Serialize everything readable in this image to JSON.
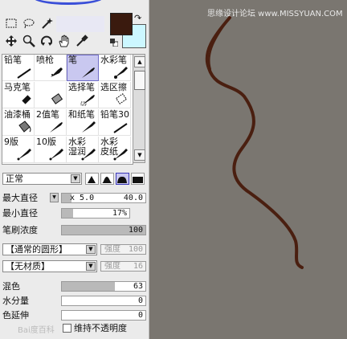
{
  "tools": {
    "row1": [
      "select-icon",
      "lasso-icon",
      "magic-wand-icon"
    ],
    "row2": [
      "move-icon",
      "zoom-icon",
      "rotate-icon",
      "hand-icon",
      "eyedropper-icon"
    ]
  },
  "colors": {
    "foreground": "#3a1a0e",
    "background": "#ccf7ff",
    "stroke": "#4a1f10",
    "canvas": "#7a7670"
  },
  "brushes": [
    {
      "label": "铅笔",
      "icon": "pencil"
    },
    {
      "label": "喷枪",
      "icon": "airbrush"
    },
    {
      "label": "笔",
      "icon": "pen",
      "selected": true
    },
    {
      "label": "水彩笔",
      "icon": "watercolor"
    },
    {
      "label": "马克笔",
      "icon": "marker"
    },
    {
      "label": "",
      "icon": "eraser"
    },
    {
      "label": "选择笔",
      "icon": "select-pen"
    },
    {
      "label": "选区擦",
      "icon": "select-eraser"
    },
    {
      "label": "油漆桶",
      "icon": "bucket"
    },
    {
      "label": "2值笔",
      "icon": "binary-pen"
    },
    {
      "label": "和纸笔",
      "icon": "washi-pen"
    },
    {
      "label": "铅笔30",
      "icon": "pencil"
    },
    {
      "label": "9版",
      "icon": "brush"
    },
    {
      "label": "10版",
      "icon": "brush"
    },
    {
      "label": "水彩\n湿润",
      "icon": "brush"
    },
    {
      "label": "水彩\n皮纸",
      "icon": "brush"
    }
  ],
  "blend_mode": "正常",
  "brush_shapes": [
    "tip-sharp",
    "tip-round",
    "tip-soft",
    "tip-flat"
  ],
  "max_size": {
    "label": "最大直径",
    "prefix": "x 5.0",
    "value": "40.0",
    "fill": 0.12
  },
  "min_size": {
    "label": "最小直径",
    "value": "17%",
    "fill": 0.17
  },
  "density": {
    "label": "笔刷浓度",
    "value": "100",
    "fill": 1.0
  },
  "shape": {
    "value": "【通常的圆形】",
    "strength_label": "强度",
    "strength_value": "100"
  },
  "texture": {
    "value": "【无材质】",
    "strength_label": "强度",
    "strength_value": "16"
  },
  "blending": {
    "label": "混色",
    "value": "63",
    "fill": 0.63
  },
  "water": {
    "label": "水分量",
    "value": "0",
    "fill": 0
  },
  "persistence": {
    "label": "色延伸",
    "value": "0",
    "fill": 0
  },
  "keep_opacity": {
    "label": "维持不透明度",
    "checked": false
  },
  "watermark_top": "思缘设计论坛 www.MISSYUAN.COM",
  "watermark_bottom": "Bai度百科"
}
